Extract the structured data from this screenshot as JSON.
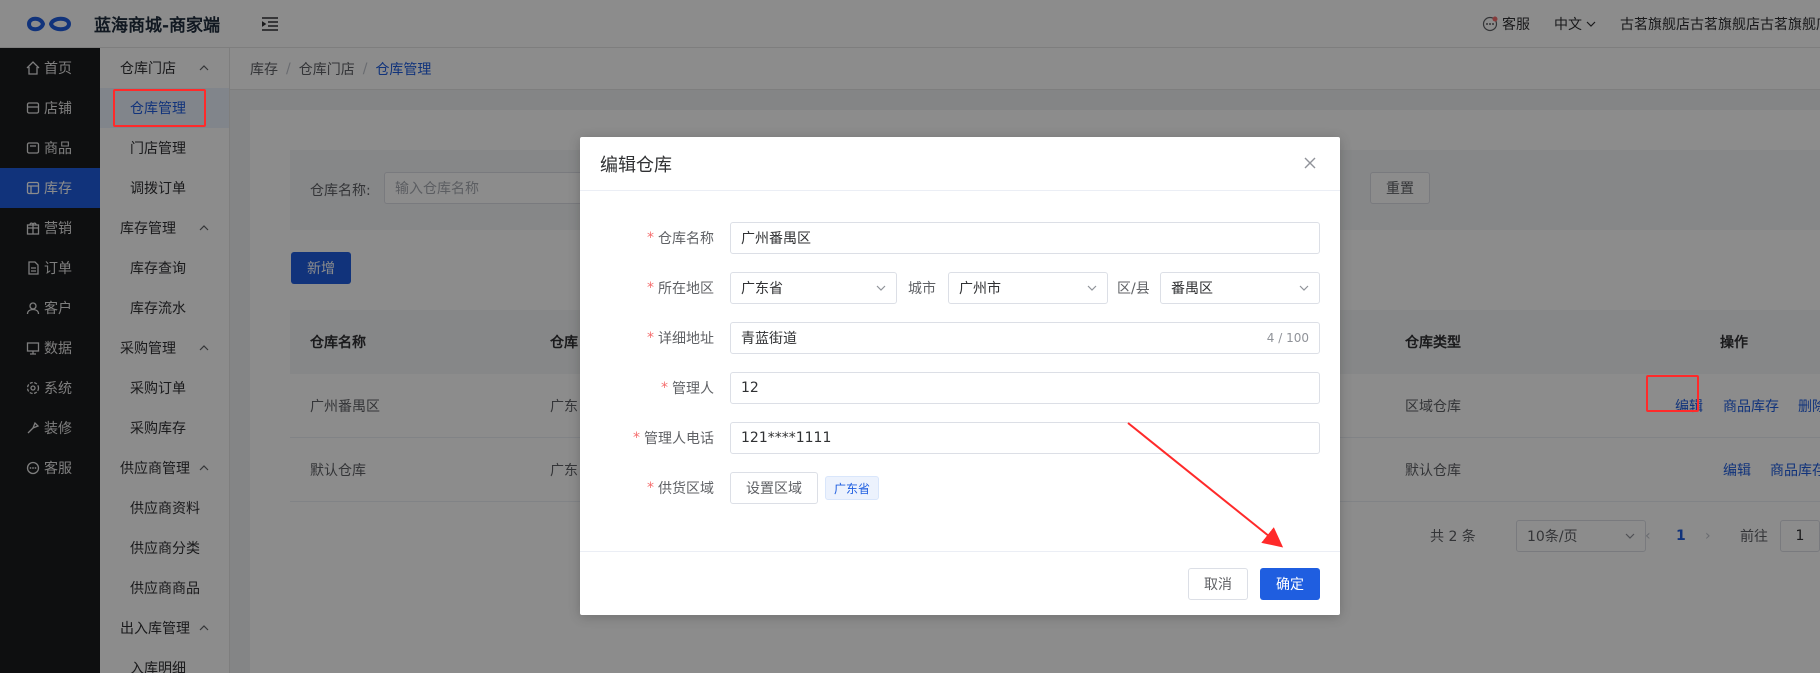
{
  "app": {
    "title": "蓝海商城-商家端"
  },
  "header": {
    "service_label": "客服",
    "language": "中文",
    "shop_name": "古茗旗舰店古茗旗舰店古茗旗舰店"
  },
  "sidebar": {
    "items": [
      {
        "label": "首页",
        "icon": "home-icon"
      },
      {
        "label": "店铺",
        "icon": "shop-icon"
      },
      {
        "label": "商品",
        "icon": "goods-icon"
      },
      {
        "label": "库存",
        "icon": "inventory-icon",
        "active": true
      },
      {
        "label": "营销",
        "icon": "marketing-icon"
      },
      {
        "label": "订单",
        "icon": "order-icon"
      },
      {
        "label": "客户",
        "icon": "customer-icon"
      },
      {
        "label": "数据",
        "icon": "data-icon"
      },
      {
        "label": "系统",
        "icon": "settings-icon"
      },
      {
        "label": "装修",
        "icon": "decorate-icon"
      },
      {
        "label": "客服",
        "icon": "service-icon"
      }
    ]
  },
  "subsidebar": {
    "groups": [
      {
        "label": "仓库门店",
        "items": [
          "仓库管理",
          "门店管理",
          "调拨订单"
        ]
      },
      {
        "label": "库存管理",
        "items": [
          "库存查询",
          "库存流水"
        ]
      },
      {
        "label": "采购管理",
        "items": [
          "采购订单",
          "采购库存"
        ]
      },
      {
        "label": "供应商管理",
        "items": [
          "供应商资料",
          "供应商分类",
          "供应商商品"
        ]
      },
      {
        "label": "出入库管理",
        "items": [
          "入库明细"
        ]
      }
    ]
  },
  "breadcrumb": {
    "items": [
      "库存",
      "仓库门店",
      "仓库管理"
    ]
  },
  "search": {
    "label": "仓库名称:",
    "placeholder": "输入仓库名称",
    "reset_label": "重置"
  },
  "add_label": "新增",
  "table": {
    "headers": {
      "name": "仓库名称",
      "area": "仓库",
      "type": "仓库类型",
      "actions": "操作"
    },
    "rows": [
      {
        "name": "广州番禺区",
        "area": "广东",
        "type": "区域仓库",
        "edit": "编辑",
        "stock": "商品库存",
        "delete": "删除"
      },
      {
        "name": "默认仓库",
        "area": "广东",
        "type": "默认仓库",
        "edit": "编辑",
        "stock": "商品库存"
      }
    ]
  },
  "pagination": {
    "total": "共 2 条",
    "page_size": "10条/页",
    "current": "1",
    "goto_label": "前往",
    "goto_value": "1"
  },
  "dialog": {
    "title": "编辑仓库",
    "name_label": "仓库名称",
    "name_value": "广州番禺区",
    "region_label": "所在地区",
    "province": "广东省",
    "city_label": "城市",
    "city": "广州市",
    "district_label": "区/县",
    "district": "番禺区",
    "address_label": "详细地址",
    "address_value": "青蓝街道",
    "address_counter": "4 / 100",
    "manager_label": "管理人",
    "manager_value": "12",
    "phone_label": "管理人电话",
    "phone_value": "121****1111",
    "supply_label": "供货区域",
    "set_area_label": "设置区域",
    "supply_tag": "广东省",
    "cancel_label": "取消",
    "ok_label": "确定"
  },
  "colors": {
    "primary": "#1f5ee0",
    "sidebar_bg": "#1b1c1e",
    "highlight": "#ff2a2a",
    "required": "#f56c6c"
  }
}
